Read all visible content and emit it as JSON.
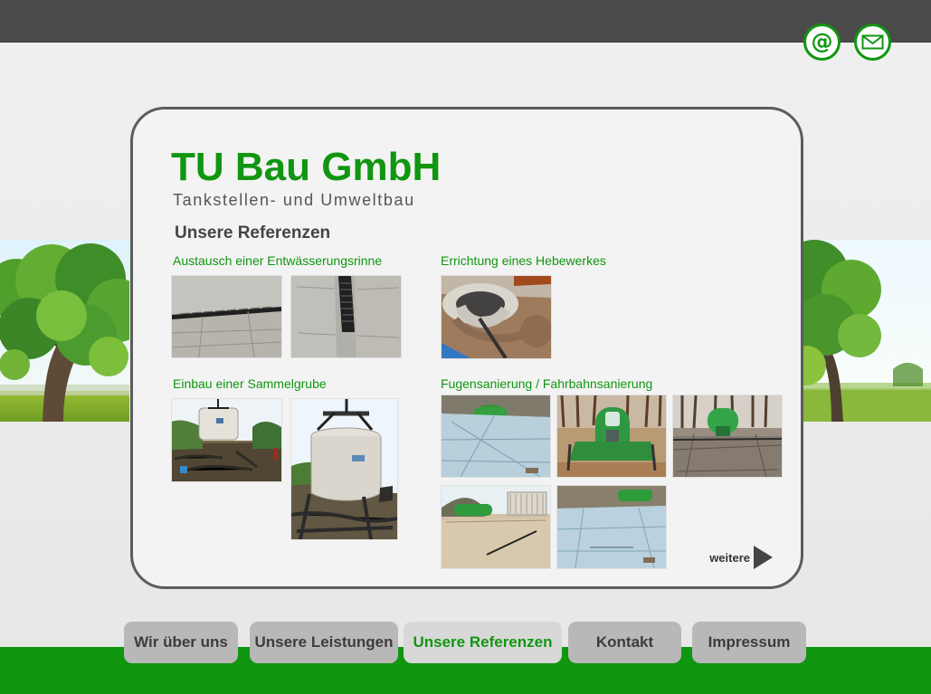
{
  "header": {
    "icons": [
      {
        "name": "at-icon",
        "glyph": "@",
        "accent_color": "#109610"
      },
      {
        "name": "mail-icon",
        "accent_color": "#109610"
      }
    ]
  },
  "brand": {
    "title": "TU Bau GmbH",
    "subtitle": "Tankstellen- und Umweltbau",
    "color": "#109610"
  },
  "content": {
    "section_title": "Unsere Referenzen",
    "references": [
      {
        "caption": "Austausch einer Entwässerungsrinne",
        "images": [
          "drainage-channel-photo",
          "drainage-channel-photo"
        ]
      },
      {
        "caption": "Errichtung eines Hebewerkes",
        "images": [
          "lifting-station-photo"
        ]
      },
      {
        "caption": "Einbau einer Sammelgrube",
        "images": [
          "collection-pit-photo",
          "collection-pit-photo"
        ]
      },
      {
        "caption": "Fugensanierung / Fahrbahnsanierung",
        "images": [
          "joint-repair-photo",
          "joint-repair-photo",
          "joint-repair-photo",
          "joint-repair-photo",
          "joint-repair-photo"
        ]
      }
    ],
    "more_label": "weitere",
    "more_icon": "play-arrow-icon"
  },
  "navigation": {
    "items": [
      {
        "label": "Wir über uns",
        "active": false
      },
      {
        "label": "Unsere Leistungen",
        "active": false
      },
      {
        "label": "Unsere Referenzen",
        "active": true
      },
      {
        "label": "Kontakt",
        "active": false
      },
      {
        "label": "Impressum",
        "active": false
      }
    ]
  },
  "colors": {
    "accent": "#109610",
    "top_bar": "#4a4a4a",
    "panel_border": "#5c5c5c",
    "background": "#e9e9e9",
    "nav_background": "#b8b8b8",
    "active_nav_background": "#d8d8d8"
  }
}
